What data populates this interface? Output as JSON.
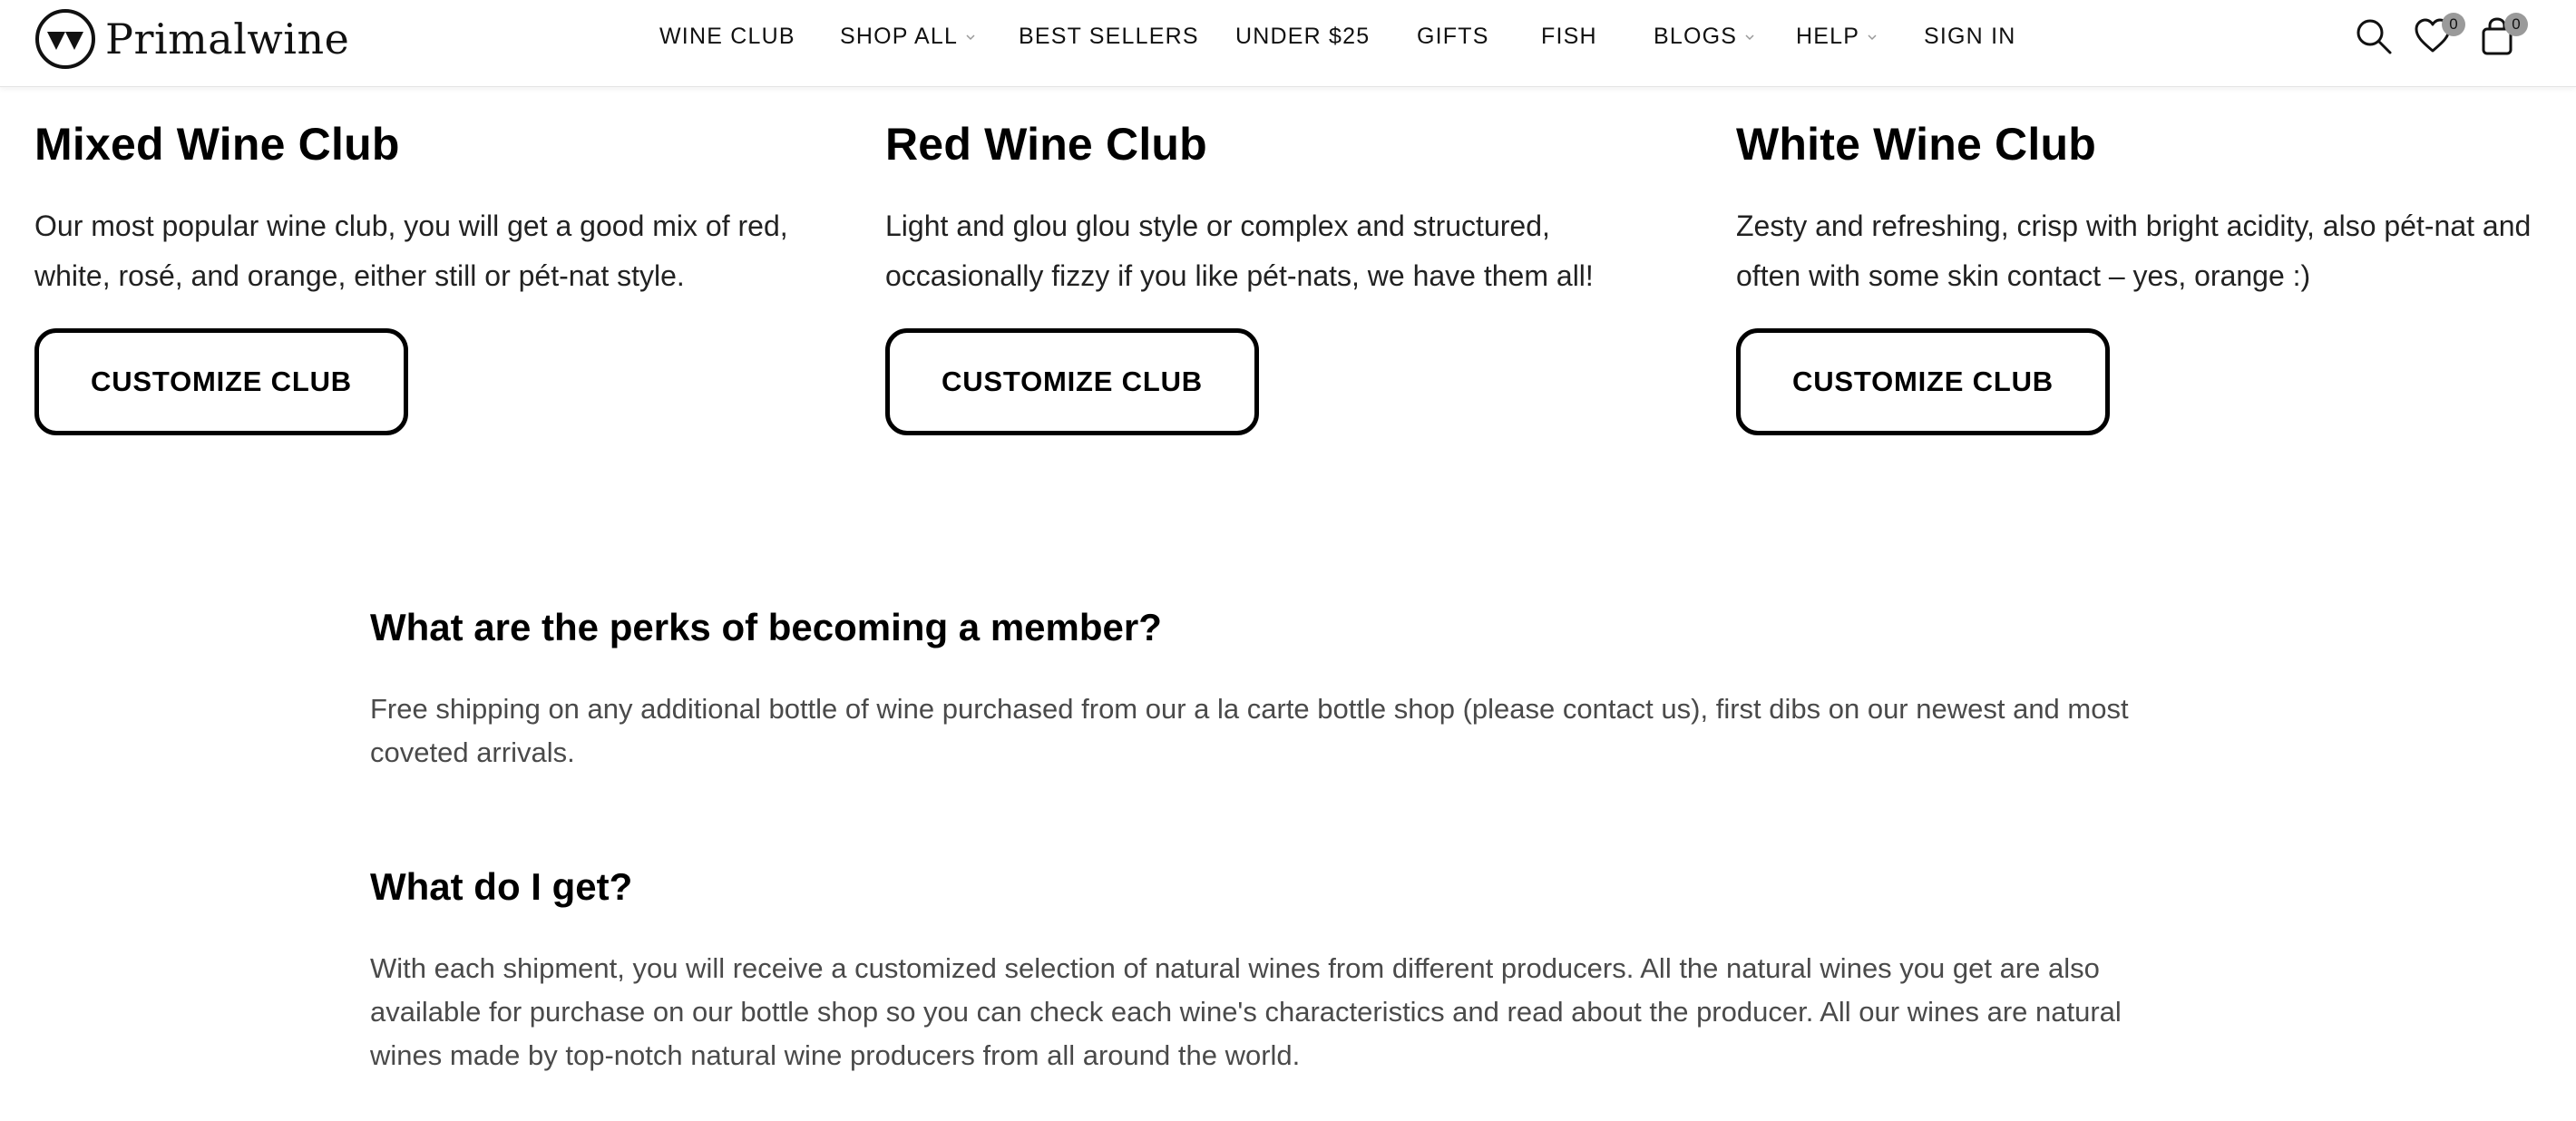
{
  "brand": {
    "name": "Primalwine",
    "logo_icon": "wine-glasses-logo-icon"
  },
  "nav": {
    "items": [
      {
        "label": "WINE CLUB",
        "dropdown": false
      },
      {
        "label": "SHOP ALL",
        "dropdown": true
      },
      {
        "label": "BEST SELLERS",
        "dropdown": false
      },
      {
        "label": "UNDER $25",
        "dropdown": false
      },
      {
        "label": "GIFTS",
        "dropdown": false
      },
      {
        "label": "FISH",
        "dropdown": false
      },
      {
        "label": "BLOGS",
        "dropdown": true
      },
      {
        "label": "HELP",
        "dropdown": true
      },
      {
        "label": "SIGN IN",
        "dropdown": false
      }
    ]
  },
  "header_icons": {
    "search_icon": "search-icon",
    "wishlist_icon": "heart-icon",
    "wishlist_count": "0",
    "cart_icon": "shopping-bag-icon",
    "cart_count": "0"
  },
  "clubs": [
    {
      "title": "Mixed Wine Club",
      "description": "Our most popular wine club, you will get a good mix of red, white, rosé, and orange, either still or pét-nat style.",
      "button": "CUSTOMIZE CLUB"
    },
    {
      "title": "Red Wine Club",
      "description": "Light and glou glou style or complex and structured, occasionally fizzy if you like pét-nats, we have them all!",
      "button": "CUSTOMIZE CLUB"
    },
    {
      "title": "White Wine Club",
      "description": "Zesty and refreshing, crisp with bright acidity, also pét-nat and often with some skin contact – yes, orange :)",
      "button": "CUSTOMIZE CLUB"
    }
  ],
  "faq": [
    {
      "question": "What are the perks of becoming a member?",
      "answer": "Free shipping on any additional bottle of wine purchased from our a la carte bottle shop (please contact us), first dibs on our newest and most coveted arrivals."
    },
    {
      "question": "What do I get?",
      "answer": "With each shipment, you will receive a customized selection of natural wines from different producers. All the natural wines you get are also available for purchase on our bottle shop so you can check each wine's characteristics and read about the producer. All our wines are natural wines made by top-notch natural wine producers from all around the world."
    }
  ],
  "colors": {
    "text": "#000000",
    "body_text": "#4a4a4a",
    "badge": "#9a9a9a",
    "border": "#000000"
  }
}
